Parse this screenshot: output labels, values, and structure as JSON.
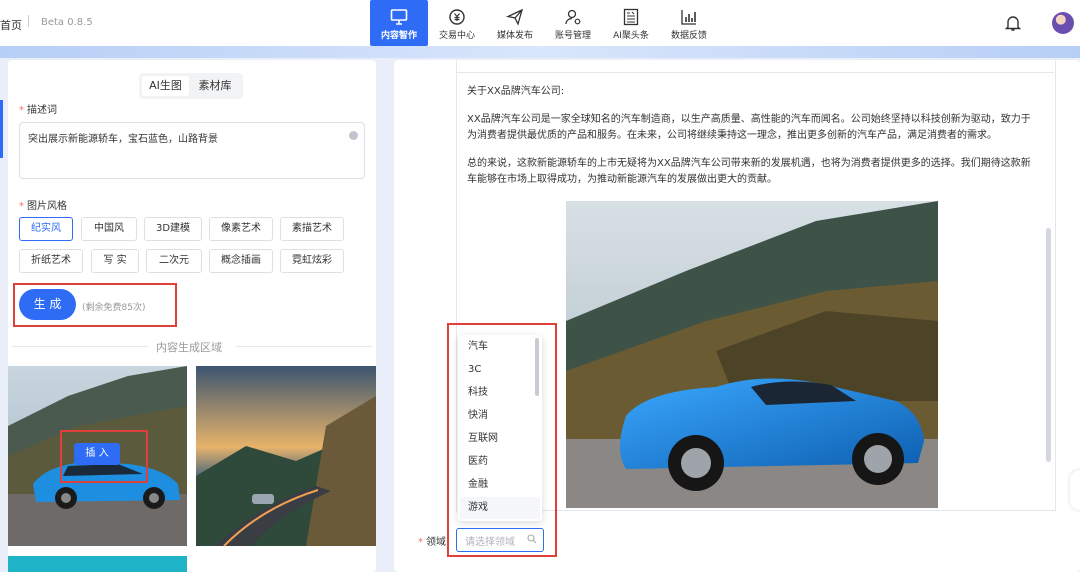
{
  "header": {
    "home": "首页",
    "version": "Beta 0.8.5",
    "nav": [
      {
        "label": "内容智作",
        "icon": "monitor-icon",
        "active": true
      },
      {
        "label": "交易中心",
        "icon": "yuan-coin-icon",
        "active": false
      },
      {
        "label": "媒体发布",
        "icon": "paper-plane-icon",
        "active": false
      },
      {
        "label": "账号管理",
        "icon": "user-gear-icon",
        "active": false
      },
      {
        "label": "AI聚头条",
        "icon": "news-icon",
        "active": false
      },
      {
        "label": "数据反馈",
        "icon": "bar-chart-icon",
        "active": false
      }
    ]
  },
  "left": {
    "tabs": [
      "AI生图",
      "素材库"
    ],
    "desc_label": "描述词",
    "desc_value": "突出展示新能源轿车，宝石蓝色，山路背景",
    "style_label": "图片风格",
    "styles": [
      "纪实风",
      "中国风",
      "3D建模",
      "像素艺术",
      "素描艺术",
      "折纸艺术",
      "写 实",
      "二次元",
      "概念插画",
      "霓虹炫彩"
    ],
    "selected_style": "纪实风",
    "generate": "生 成",
    "free_note": "(剩余免费85次)",
    "area_title": "内容生成区域",
    "insert": "插 入"
  },
  "editor": {
    "paragraphs": [
      "关于XX品牌汽车公司:",
      "XX品牌汽车公司是一家全球知名的汽车制造商，以生产高质量、高性能的汽车而闻名。公司始终坚持以科技创新为驱动，致力于为消费者提供最优质的产品和服务。在未来，公司将继续秉持这一理念，推出更多创新的汽车产品，满足消费者的需求。",
      "总的来说，这款新能源轿车的上市无疑将为XX品牌汽车公司带来新的发展机遇，也将为消费者提供更多的选择。我们期待这款新车能够在市场上取得成功，为推动新能源汽车的发展做出更大的贡献。"
    ]
  },
  "domain_field": {
    "label": "领域",
    "placeholder": "请选择领域",
    "options": [
      "汽车",
      "3C",
      "科技",
      "快消",
      "互联网",
      "医药",
      "金融",
      "游戏"
    ],
    "hovered": "游戏"
  },
  "colors": {
    "accent": "#2f6cf5",
    "highlight_box": "#e0403a",
    "car_blue": "#1e8fe0"
  }
}
